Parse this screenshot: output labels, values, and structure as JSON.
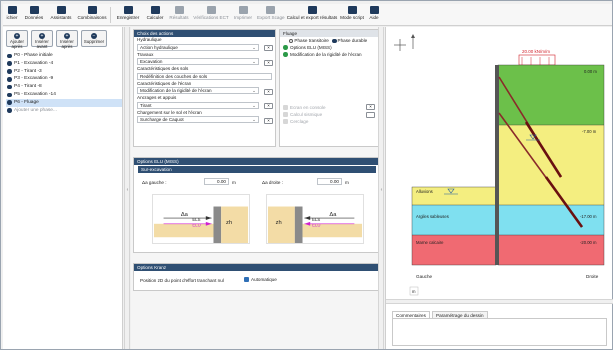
{
  "ribbon": {
    "items": [
      {
        "label": "ichier",
        "icon": "file-icon",
        "enabled": true
      },
      {
        "label": "Données",
        "icon": "grid-icon",
        "enabled": true
      },
      {
        "label": "Assistants",
        "icon": "wizard-icon",
        "enabled": true
      },
      {
        "label": "Combinaisons",
        "icon": "combination-icon",
        "enabled": true
      },
      {
        "label": "Enregistrer",
        "icon": "save-icon",
        "enabled": true
      },
      {
        "label": "Calculer",
        "icon": "sigma-icon",
        "enabled": true
      },
      {
        "label": "Résultats",
        "icon": "results-icon",
        "enabled": false
      },
      {
        "label": "Vérifications ECT",
        "icon": "check-icon",
        "enabled": false
      },
      {
        "label": "Imprimer",
        "icon": "print-icon",
        "enabled": false
      },
      {
        "label": "Export Scage",
        "icon": "export-icon",
        "enabled": false
      },
      {
        "label": "Calcul et export résultats",
        "icon": "calc-export-icon",
        "enabled": true
      },
      {
        "label": "Mode script",
        "icon": "code-icon",
        "enabled": true
      },
      {
        "label": "Aide",
        "icon": "help-icon",
        "enabled": true
      }
    ]
  },
  "phase_buttons": {
    "add": "Ajouter après",
    "insert_before": "Insérer avant",
    "insert_after": "Insérer après",
    "delete": "Supprimer"
  },
  "phases": [
    {
      "label": "P0 - Phase initiale",
      "selected": false
    },
    {
      "label": "P1 - Excavation -4",
      "selected": false
    },
    {
      "label": "P2 - Tirant -3",
      "selected": false
    },
    {
      "label": "P3 - Excavation -9",
      "selected": false
    },
    {
      "label": "P4 - Tirant -8",
      "selected": false
    },
    {
      "label": "P5 - Excavation -14",
      "selected": false
    },
    {
      "label": "P6 - Fluage",
      "selected": true
    }
  ],
  "add_phase": "Ajouter une phase...",
  "actions": {
    "header": "Choix des actions",
    "groups": [
      {
        "title": "Hydraulique",
        "value": "Action hydraulique"
      },
      {
        "title": "Travaux",
        "value": "Excavation"
      },
      {
        "title": "Caractéristiques des sols",
        "value": "Redéfinition des couches de sols"
      },
      {
        "title": "Caractéristiques de l'écran",
        "value": "Modification de la rigidité de l'écran"
      },
      {
        "title": "Ancrages et appuis",
        "value": "Tirant"
      },
      {
        "title": "Chargement sur le sol et l'écran",
        "value": "Surcharge de Caquot"
      }
    ],
    "remove_symbol": "×",
    "chevron": "⌄"
  },
  "fluage": {
    "header": "Fluage",
    "radio_transitory": "Phase transitoire",
    "radio_durable": "Phase durable",
    "items": [
      "Options ELU (MISS)",
      "Modification de la rigidité de l'écran"
    ],
    "disabled_items": [
      "Ecran en console",
      "Calcul sismique",
      "Cerclage"
    ]
  },
  "elu": {
    "header": "Options ELU (MISS)",
    "sub_header": "Sur-excavation",
    "left_label": "Δa gauche :",
    "left_value": "0.00",
    "right_label": "Δa droite :",
    "right_value": "0.00",
    "unit": "m",
    "diagram_left": {
      "delta": "Δa",
      "els": "ELS",
      "elu": "ELU",
      "zh": "zh"
    },
    "diagram_right": {
      "delta": "Δa",
      "els": "ELS",
      "elu": "ELU",
      "zh": "zh"
    }
  },
  "kranz": {
    "header": "Options Kranz",
    "label": "Position zD du point d'effort tranchant nul",
    "checkbox": "Automatique"
  },
  "drawing": {
    "surcharge_label": "20.00 kN/m/m",
    "levels": [
      "0.00 m",
      "-7.00 m",
      "-17.00 m",
      "-20.00 m"
    ],
    "layers": [
      "Alluvions",
      "Argiles sableuses",
      "Marne calcaire"
    ],
    "left_side": "Gauche",
    "right_side": "Droite",
    "scale_label": "m",
    "colors": {
      "green": "#6cc04a",
      "yellow": "#f4ee80",
      "cyan": "#7fe0f0",
      "red": "#f06a72"
    }
  },
  "bottom_tabs": [
    "Commentaires",
    "Paramétrage du dessin"
  ]
}
